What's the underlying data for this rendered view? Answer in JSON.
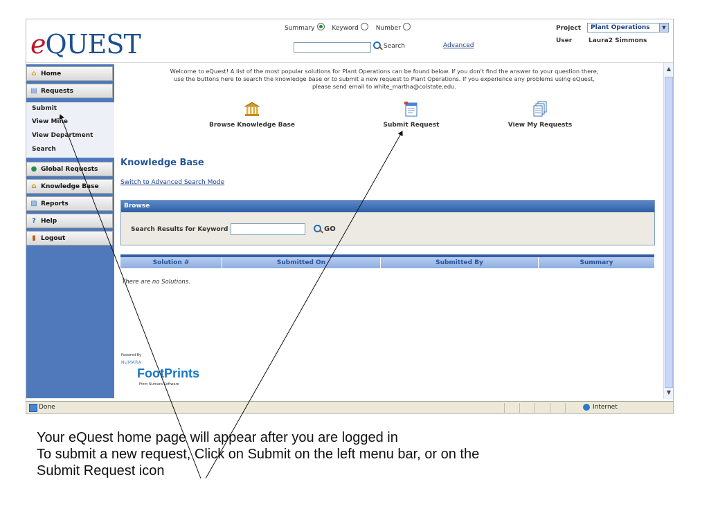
{
  "header": {
    "logo_e": "e",
    "logo_quest": "QUEST",
    "search_modes": [
      "Summary",
      "Keyword",
      "Number"
    ],
    "selected_mode": "Summary",
    "search_button": "Search",
    "advanced_link": "Advanced",
    "project_label": "Project",
    "project_value": "Plant Operations",
    "user_label": "User",
    "user_value": "Laura2 Simmons"
  },
  "sidebar": {
    "home": "Home",
    "requests": "Requests",
    "sub_items": [
      "Submit",
      "View Mine",
      "View Department",
      "Search"
    ],
    "global_requests": "Global Requests",
    "knowledge_base": "Knowledge Base",
    "reports": "Reports",
    "help": "Help",
    "logout": "Logout"
  },
  "main": {
    "welcome": "Welcome to eQuest! A list of the most popular solutions for Plant Operations can be found below. If you don't find the answer to your question there, use the buttons here to search the knowledge base or to submit a new request to Plant Operations. If you experience any problems using eQuest, please send email to white_martha@colstate.edu.",
    "icons": {
      "browse_kb": "Browse Knowledge Base",
      "submit_request": "Submit Request",
      "view_my_requests": "View My Requests"
    },
    "kb_title": "Knowledge Base",
    "advanced_mode_link": "Switch to Advanced Search Mode",
    "browse_header": "Browse",
    "keyword_label": "Search Results for Keyword",
    "go_button": "GO",
    "table_columns": [
      "Solution #",
      "Submitted On",
      "Submitted By",
      "Summary"
    ],
    "no_solutions": "There are no Solutions.",
    "powered_by": "Powered By",
    "numara": "NUMARA",
    "footprints": "FootPrints",
    "from_numara": "From Numara Software"
  },
  "statusbar": {
    "done": "Done",
    "zone": "Internet"
  },
  "caption": {
    "line1": "Your eQuest home page will appear after you are logged in",
    "line2": "To submit a new request, Click on Submit on the left menu bar, or on the",
    "line3": "Submit Request icon"
  },
  "colors": {
    "sidebar_bg": "#4f79ba",
    "header_bar": "#2f5fa6",
    "link": "#1a3e8c",
    "logo_e": "#b8182b",
    "logo_quest": "#1e4f8f"
  }
}
